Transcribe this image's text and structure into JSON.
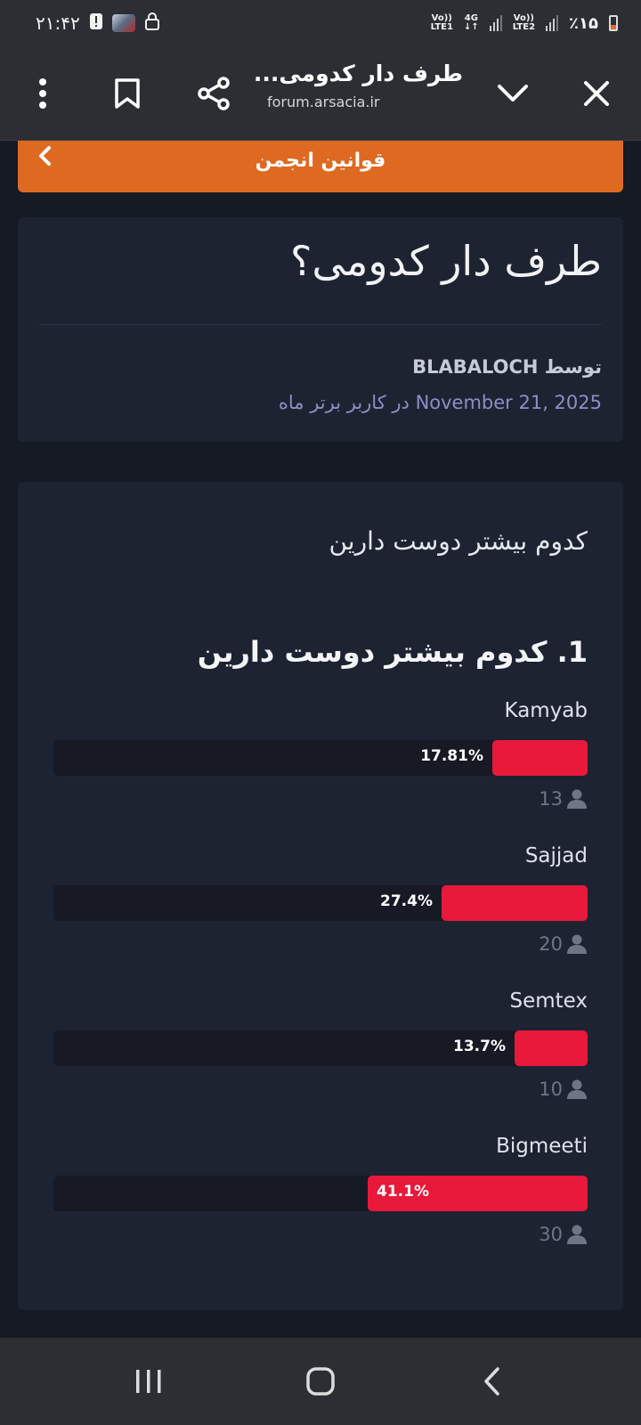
{
  "status_bar": {
    "time": "۲۱:۴۲",
    "battery_text": "٪۱۵",
    "net_labels": [
      "Vo))",
      "LTE2",
      "4G",
      "↓↑",
      "Vo))",
      "LTE1"
    ]
  },
  "browser": {
    "tab_title": "طرف دار کدومی...",
    "url": "forum.arsacia.ir"
  },
  "rules_button": {
    "label": "قوانین انجمن"
  },
  "thread": {
    "title": "طرف دار کدومی؟",
    "author_line": "توسط BLABALOCH",
    "meta_line": "November 21, 2025 در کاربر برتر ماه"
  },
  "poll": {
    "question": "کدوم بیشتر دوست دارین",
    "heading": "1. کدوم بیشتر دوست دارین",
    "options": [
      {
        "label": "Kamyab",
        "percent_text": "17.81%",
        "percent": 17.81,
        "votes": "13"
      },
      {
        "label": "Sajjad",
        "percent_text": "27.4%",
        "percent": 27.4,
        "votes": "20"
      },
      {
        "label": "Semtex",
        "percent_text": "13.7%",
        "percent": 13.7,
        "votes": "10"
      },
      {
        "label": "Bigmeeti",
        "percent_text": "41.1%",
        "percent": 41.1,
        "votes": "30"
      }
    ]
  },
  "colors": {
    "accent_orange": "#de6a22",
    "poll_bar": "#e8193b",
    "card_bg": "#1e2332",
    "page_bg": "#151a24"
  }
}
